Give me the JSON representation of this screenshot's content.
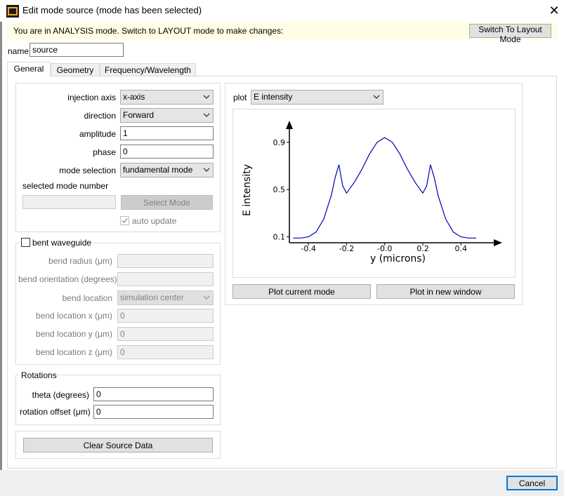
{
  "window": {
    "title": "Edit mode source (mode has been selected)",
    "close_glyph": "✕"
  },
  "banner": {
    "message": "You are in ANALYSIS mode.  Switch to LAYOUT mode to make changes:",
    "switch_button": "Switch To Layout Mode"
  },
  "name_field": {
    "label": "name",
    "value": "source"
  },
  "tabs": [
    {
      "label": "General",
      "active": true
    },
    {
      "label": "Geometry",
      "active": false
    },
    {
      "label": "Frequency/Wavelength",
      "active": false
    }
  ],
  "general": {
    "injection_axis": {
      "label": "injection axis",
      "value": "x-axis"
    },
    "direction": {
      "label": "direction",
      "value": "Forward"
    },
    "amplitude": {
      "label": "amplitude",
      "value": "1"
    },
    "phase": {
      "label": "phase",
      "value": "0"
    },
    "mode_selection": {
      "label": "mode selection",
      "value": "fundamental mode"
    },
    "selected_mode_number": {
      "label": "selected mode number",
      "value": ""
    },
    "select_mode_button": "Select Mode",
    "auto_update": {
      "label": "auto update",
      "checked": true
    }
  },
  "bent": {
    "checkbox_label": "bent waveguide",
    "checked": false,
    "bend_radius": {
      "label": "bend radius (μm)",
      "value": ""
    },
    "bend_orientation": {
      "label": "bend orientation (degrees)",
      "value": ""
    },
    "bend_location": {
      "label": "bend location",
      "value": "simulation center"
    },
    "bend_location_x": {
      "label": "bend location x (μm)",
      "value": "0"
    },
    "bend_location_y": {
      "label": "bend location y (μm)",
      "value": "0"
    },
    "bend_location_z": {
      "label": "bend location z (μm)",
      "value": "0"
    }
  },
  "rotations": {
    "title": "Rotations",
    "theta": {
      "label": "theta (degrees)",
      "value": "0"
    },
    "offset": {
      "label": "rotation offset (μm)",
      "value": "0"
    }
  },
  "clear_button": "Clear Source Data",
  "plot_panel": {
    "label": "plot",
    "selected": "E intensity",
    "plot_current_button": "Plot current mode",
    "plot_new_window_button": "Plot in new window"
  },
  "cancel_button": "Cancel",
  "colors": {
    "curve": "#0000b8",
    "banner_bg": "#fffde3",
    "accent_border": "#0078d7"
  },
  "icons": {
    "app": "lumerical-app-icon",
    "close": "close-icon",
    "dropdown": "chevron-down-icon",
    "check": "checkmark-icon"
  },
  "chart_data": {
    "type": "line",
    "title": "",
    "xlabel": "y (microns)",
    "ylabel": "E intensity",
    "xlim": [
      -0.5,
      0.55
    ],
    "ylim": [
      0.05,
      1.0
    ],
    "xticks": [
      -0.4,
      -0.2,
      -0.0,
      0.2,
      0.4
    ],
    "xtick_labels": [
      "-0.4",
      "-0.2",
      "-0.0",
      "0.2",
      "0.4"
    ],
    "yticks": [
      0.1,
      0.5,
      0.9
    ],
    "ytick_labels": [
      "0.1",
      "0.5",
      "0.9"
    ],
    "grid": false,
    "series": [
      {
        "x": [
          -0.48,
          -0.44,
          -0.4,
          -0.36,
          -0.32,
          -0.28,
          -0.26,
          -0.24,
          -0.22,
          -0.2,
          -0.16,
          -0.12,
          -0.08,
          -0.04,
          0.0,
          0.04,
          0.08,
          0.12,
          0.16,
          0.2,
          0.22,
          0.24,
          0.26,
          0.28,
          0.32,
          0.36,
          0.4,
          0.44,
          0.48
        ],
        "y": [
          0.09,
          0.09,
          0.1,
          0.14,
          0.25,
          0.45,
          0.6,
          0.71,
          0.53,
          0.47,
          0.56,
          0.67,
          0.8,
          0.9,
          0.94,
          0.9,
          0.8,
          0.67,
          0.56,
          0.47,
          0.53,
          0.71,
          0.6,
          0.45,
          0.25,
          0.14,
          0.1,
          0.09,
          0.09
        ]
      }
    ]
  }
}
